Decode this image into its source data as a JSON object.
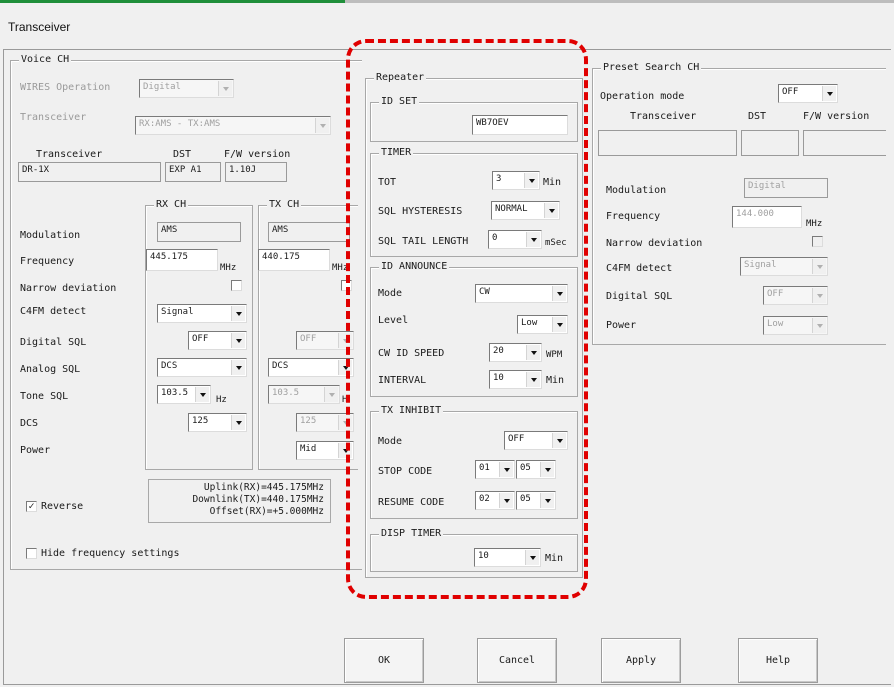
{
  "window": {
    "title": "Transceiver"
  },
  "voice_ch": {
    "group_label": "Voice CH",
    "wires_operation": {
      "label": "WIRES Operation",
      "value": "Digital"
    },
    "transceiver_row": {
      "label": "Transceiver",
      "value": "RX:AMS - TX:AMS"
    },
    "headers": {
      "transceiver": "Transceiver",
      "dst": "DST",
      "fw": "F/W version"
    },
    "values": {
      "transceiver": "DR-1X",
      "dst": "EXP A1",
      "fw": "1.10J"
    },
    "labels": {
      "modulation": "Modulation",
      "frequency": "Frequency",
      "narrow_deviation": "Narrow deviation",
      "c4fm_detect": "C4FM detect",
      "digital_sql": "Digital SQL",
      "analog_sql": "Analog SQL",
      "tone_sql": "Tone SQL",
      "dcs": "DCS",
      "power": "Power"
    },
    "rx": {
      "group_label": "RX CH",
      "modulation": "AMS",
      "frequency": "445.175",
      "freq_unit": "MHz",
      "c4fm_detect": "Signal",
      "digital_sql": "OFF",
      "analog_sql": "DCS",
      "tone_sql": "103.5",
      "tone_unit": "Hz",
      "dcs": "125"
    },
    "tx": {
      "group_label": "TX CH",
      "modulation": "AMS",
      "frequency": "440.175",
      "freq_unit": "MHz",
      "digital_sql": "OFF",
      "analog_sql": "DCS",
      "tone_sql": "103.5",
      "tone_unit": "H",
      "dcs": "125",
      "power": "Mid"
    },
    "reverse": {
      "label": "Reverse",
      "checked": true
    },
    "link_info": {
      "uplink": "Uplink(RX)=445.175MHz",
      "downlink": "Downlink(TX)=440.175MHz",
      "offset": "Offset(RX)=+5.000MHz"
    },
    "hide_freq": {
      "label": "Hide frequency settings",
      "checked": false
    }
  },
  "repeater": {
    "group_label": "Repeater",
    "id_set": {
      "group_label": "ID SET",
      "value": "WB7OEV"
    },
    "timer": {
      "group_label": "TIMER",
      "tot_label": "TOT",
      "tot_value": "3",
      "tot_unit": "Min",
      "sql_hyst_label": "SQL HYSTERESIS",
      "sql_hyst_value": "NORMAL",
      "sql_tail_label": "SQL TAIL LENGTH",
      "sql_tail_value": "0",
      "sql_tail_unit": "mSec"
    },
    "id_announce": {
      "group_label": "ID ANNOUNCE",
      "mode_label": "Mode",
      "mode_value": "CW",
      "level_label": "Level",
      "level_value": "Low",
      "cw_speed_label": "CW ID SPEED",
      "cw_speed_value": "20",
      "cw_speed_unit": "WPM",
      "interval_label": "INTERVAL",
      "interval_value": "10",
      "interval_unit": "Min"
    },
    "tx_inhibit": {
      "group_label": "TX INHIBIT",
      "mode_label": "Mode",
      "mode_value": "OFF",
      "stop_label": "STOP CODE",
      "stop_a": "01",
      "stop_b": "05",
      "resume_label": "RESUME CODE",
      "resume_a": "02",
      "resume_b": "05"
    },
    "disp_timer": {
      "group_label": "DISP TIMER",
      "value": "10",
      "unit": "Min"
    }
  },
  "preset": {
    "group_label": "Preset Search CH",
    "operation_mode_label": "Operation mode",
    "operation_mode_value": "OFF",
    "headers": {
      "transceiver": "Transceiver",
      "dst": "DST",
      "fw": "F/W version"
    },
    "modulation_label": "Modulation",
    "modulation_value": "Digital",
    "frequency_label": "Frequency",
    "frequency_value": "144.000",
    "freq_unit": "MHz",
    "narrow_label": "Narrow deviation",
    "c4fm_label": "C4FM detect",
    "c4fm_value": "Signal",
    "digital_sql_label": "Digital SQL",
    "digital_sql_value": "OFF",
    "power_label": "Power",
    "power_value": "Low"
  },
  "buttons": {
    "ok": "OK",
    "cancel": "Cancel",
    "apply": "Apply",
    "help": "Help"
  },
  "colors": {
    "highlight": "#e00000"
  }
}
